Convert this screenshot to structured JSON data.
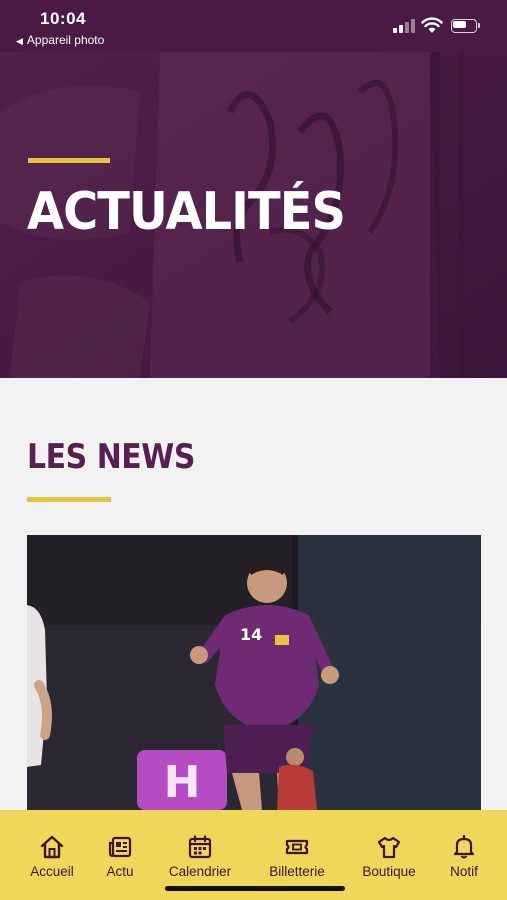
{
  "status_bar": {
    "time": "10:04",
    "back_app": "Appareil photo",
    "back_arrow": "◀",
    "signal_bars": 2,
    "battery_level": 0.6
  },
  "hero": {
    "title": "ACTUALITÉS"
  },
  "news_section": {
    "title": "LES NEWS",
    "card": {
      "player_number": "14"
    }
  },
  "tab_bar": {
    "items": [
      {
        "label": "Accueil",
        "icon": "home-icon"
      },
      {
        "label": "Actu",
        "icon": "newspaper-icon"
      },
      {
        "label": "Calendrier",
        "icon": "calendar-icon"
      },
      {
        "label": "Billetterie",
        "icon": "ticket-icon"
      },
      {
        "label": "Boutique",
        "icon": "shirt-icon"
      },
      {
        "label": "Notif",
        "icon": "bell-icon"
      }
    ]
  },
  "colors": {
    "brand_purple": "#4e1c48",
    "accent_yellow": "#e7c33e",
    "tab_bar_yellow": "#f0d75a",
    "title_purple": "#5a1f52"
  }
}
